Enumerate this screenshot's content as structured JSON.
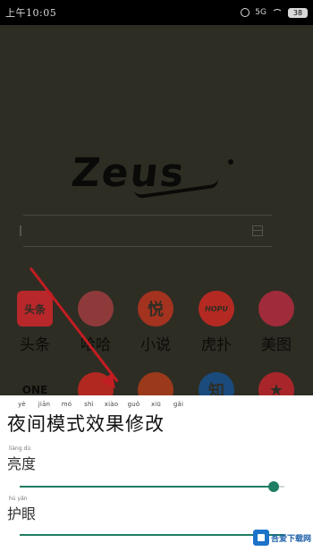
{
  "status_bar": {
    "time": "上午10:05",
    "signal_text": "5G",
    "battery": "38"
  },
  "home": {
    "logo": "Zeus",
    "search": {
      "placeholder": ""
    },
    "apps_row1": [
      {
        "name": "头条",
        "icon_text": "头条",
        "color": "#b8272a"
      },
      {
        "name": "哈哈",
        "icon_text": "",
        "color": "#8f3a3a"
      },
      {
        "name": "小说",
        "icon_text": "悦",
        "color": "#a3331f"
      },
      {
        "name": "虎扑",
        "icon_text": "HOPU",
        "color": "#b42a22"
      },
      {
        "name": "美图",
        "icon_text": "",
        "color": "#a02b3a"
      }
    ],
    "apps_row2": [
      {
        "name": "ONE",
        "icon_text": "ONE",
        "color": "#2e2d24"
      },
      {
        "name": "",
        "icon_text": "",
        "color": "#b0281f"
      },
      {
        "name": "",
        "icon_text": "",
        "color": "#9a3a1a"
      },
      {
        "name": "",
        "icon_text": "知",
        "color": "#1a4b7c"
      },
      {
        "name": "",
        "icon_text": "★",
        "color": "#a8262a"
      }
    ]
  },
  "sheet": {
    "title_pinyin": [
      "yè",
      "jiān",
      "mó",
      "shì",
      "xiào",
      "guǒ",
      "xiū",
      "gǎi"
    ],
    "title": "夜间模式效果修改",
    "brightness": {
      "pinyin": "liàng dù",
      "label": "亮度",
      "value": 0.96
    },
    "eye_care": {
      "pinyin": "hù yǎn",
      "label": "护眼",
      "value": 1.0
    }
  },
  "watermark": {
    "text": "吾爱下载网"
  },
  "colors": {
    "accent": "#1f7d64",
    "arrow": "#c21d22"
  }
}
